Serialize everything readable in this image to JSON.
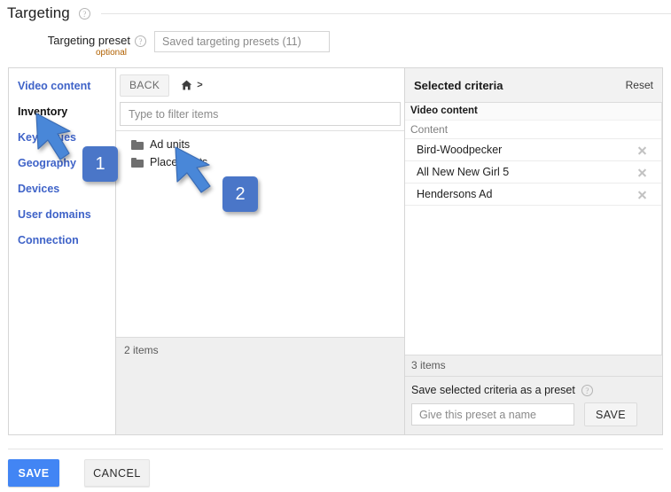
{
  "header": {
    "title": "Targeting",
    "help_icon": "help-circle-icon"
  },
  "preset": {
    "label": "Targeting preset",
    "optional": "optional",
    "help_icon": "help-circle-icon",
    "input_placeholder": "Saved targeting presets (11)",
    "input_value": ""
  },
  "sidebar": {
    "items": [
      {
        "label": "Video content",
        "active": false
      },
      {
        "label": "Inventory",
        "active": true
      },
      {
        "label": "Key-values",
        "active": false
      },
      {
        "label": "Geography",
        "active": false
      },
      {
        "label": "Devices",
        "active": false
      },
      {
        "label": "User domains",
        "active": false
      },
      {
        "label": "Connection",
        "active": false
      }
    ]
  },
  "browse": {
    "back_label": "BACK",
    "home_icon": "home-icon",
    "breadcrumb_separator": ">",
    "filter_placeholder": "Type to filter items",
    "filter_value": "",
    "rows": [
      {
        "label": "Ad units",
        "icon": "folder-icon"
      },
      {
        "label": "Placements",
        "icon": "folder-icon"
      }
    ],
    "footer_count": "2 items"
  },
  "selected": {
    "title": "Selected criteria",
    "reset_label": "Reset",
    "group_label": "Video content",
    "subgroup_label": "Content",
    "items": [
      {
        "label": "Bird-Woodpecker",
        "remove_icon": "close-icon"
      },
      {
        "label": "All New New Girl 5",
        "remove_icon": "close-icon"
      },
      {
        "label": "Hendersons Ad",
        "remove_icon": "close-icon"
      }
    ],
    "footer_count": "3 items",
    "preset_save_label": "Save selected criteria as a preset",
    "preset_save_help_icon": "help-circle-icon",
    "preset_name_placeholder": "Give this preset a name",
    "preset_name_value": "",
    "preset_save_button": "SAVE"
  },
  "actions": {
    "save_label": "SAVE",
    "cancel_label": "CANCEL"
  },
  "annotations": {
    "badge_1": "1",
    "badge_2": "2"
  },
  "colors": {
    "link_blue": "#3f63c8",
    "primary_blue": "#4285f4",
    "annotation_blue": "#4a76c8",
    "optional_orange": "#b06000",
    "panel_grey": "#efefef"
  }
}
